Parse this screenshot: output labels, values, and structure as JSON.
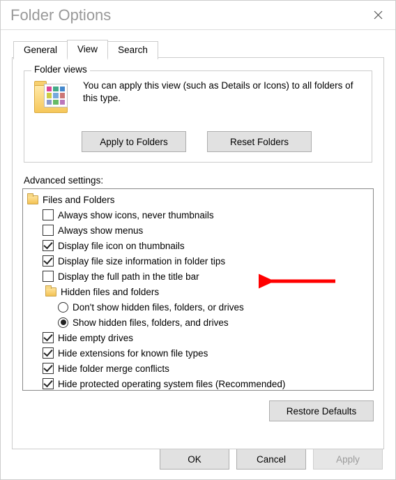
{
  "window": {
    "title": "Folder Options"
  },
  "tabs": {
    "general": "General",
    "view": "View",
    "search": "Search",
    "active": "view"
  },
  "folder_views": {
    "legend": "Folder views",
    "description": "You can apply this view (such as Details or Icons) to all folders of this type.",
    "apply_btn": "Apply to Folders",
    "reset_btn": "Reset Folders"
  },
  "advanced": {
    "label": "Advanced settings:",
    "root_label": "Files and Folders",
    "items": [
      {
        "type": "check",
        "checked": false,
        "label": "Always show icons, never thumbnails"
      },
      {
        "type": "check",
        "checked": false,
        "label": "Always show menus"
      },
      {
        "type": "check",
        "checked": true,
        "label": "Display file icon on thumbnails"
      },
      {
        "type": "check",
        "checked": true,
        "label": "Display file size information in folder tips"
      },
      {
        "type": "check",
        "checked": false,
        "label": "Display the full path in the title bar"
      },
      {
        "type": "group",
        "label": "Hidden files and folders"
      },
      {
        "type": "radio",
        "selected": false,
        "label": "Don't show hidden files, folders, or drives"
      },
      {
        "type": "radio",
        "selected": true,
        "label": "Show hidden files, folders, and drives"
      },
      {
        "type": "check",
        "checked": true,
        "label": "Hide empty drives"
      },
      {
        "type": "check",
        "checked": true,
        "label": "Hide extensions for known file types"
      },
      {
        "type": "check",
        "checked": true,
        "label": "Hide folder merge conflicts"
      },
      {
        "type": "check",
        "checked": true,
        "label": "Hide protected operating system files (Recommended)"
      }
    ],
    "restore_btn": "Restore Defaults"
  },
  "bottom": {
    "ok": "OK",
    "cancel": "Cancel",
    "apply": "Apply"
  }
}
